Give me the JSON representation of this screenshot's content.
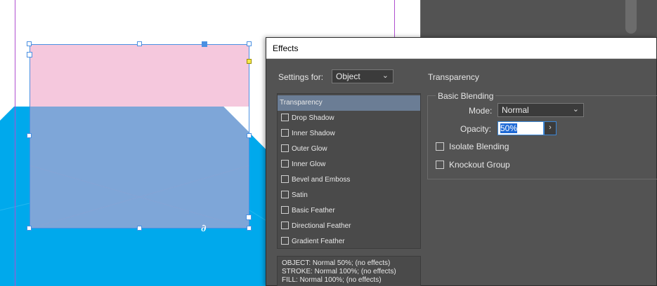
{
  "dialog": {
    "title": "Effects",
    "settings_for_label": "Settings for:",
    "settings_for_value": "Object",
    "section_title": "Transparency",
    "effects_list": [
      {
        "label": "Transparency",
        "selected": true,
        "has_checkbox": false
      },
      {
        "label": "Drop Shadow",
        "selected": false,
        "has_checkbox": true
      },
      {
        "label": "Inner Shadow",
        "selected": false,
        "has_checkbox": true
      },
      {
        "label": "Outer Glow",
        "selected": false,
        "has_checkbox": true
      },
      {
        "label": "Inner Glow",
        "selected": false,
        "has_checkbox": true
      },
      {
        "label": "Bevel and Emboss",
        "selected": false,
        "has_checkbox": true
      },
      {
        "label": "Satin",
        "selected": false,
        "has_checkbox": true
      },
      {
        "label": "Basic Feather",
        "selected": false,
        "has_checkbox": true
      },
      {
        "label": "Directional Feather",
        "selected": false,
        "has_checkbox": true
      },
      {
        "label": "Gradient Feather",
        "selected": false,
        "has_checkbox": true
      }
    ],
    "summary_lines": [
      "OBJECT: Normal 50%; (no effects)",
      "STROKE: Normal 100%; (no effects)",
      "FILL: Normal 100%; (no effects)"
    ],
    "basic_blending": {
      "group_title": "Basic Blending",
      "mode_label": "Mode:",
      "mode_value": "Normal",
      "opacity_label": "Opacity:",
      "opacity_value": "50%",
      "isolate_blending_label": "Isolate Blending",
      "knockout_group_label": "Knockout Group"
    }
  },
  "canvas": {
    "anchor_glyph": "∂",
    "colors": {
      "pink_rect": "#f5c8dd",
      "cyan_shape": "#00a9ec",
      "overlap": "#7ea6d8",
      "selection": "#4a90e2",
      "margin_guide": "#b04fd0"
    }
  },
  "icons": {
    "dropdown_chevron": "chevron-down-icon",
    "stepper_arrow": "chevron-right-icon"
  }
}
